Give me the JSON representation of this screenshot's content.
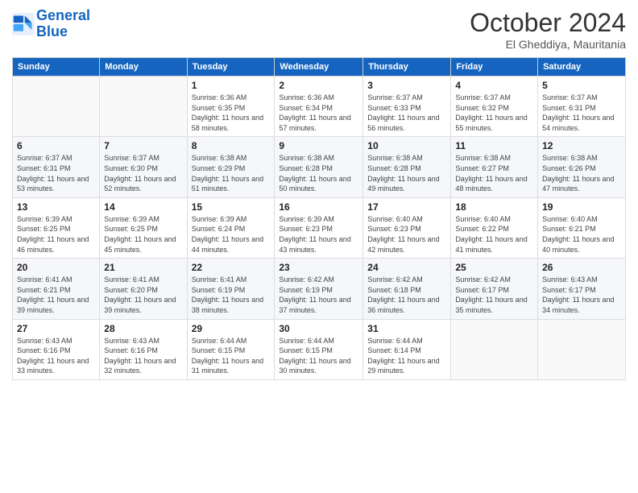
{
  "logo": {
    "line1": "General",
    "line2": "Blue"
  },
  "title": "October 2024",
  "location": "El Gheddiya, Mauritania",
  "days_of_week": [
    "Sunday",
    "Monday",
    "Tuesday",
    "Wednesday",
    "Thursday",
    "Friday",
    "Saturday"
  ],
  "weeks": [
    [
      {
        "day": "",
        "info": ""
      },
      {
        "day": "",
        "info": ""
      },
      {
        "day": "1",
        "info": "Sunrise: 6:36 AM\nSunset: 6:35 PM\nDaylight: 11 hours and 58 minutes."
      },
      {
        "day": "2",
        "info": "Sunrise: 6:36 AM\nSunset: 6:34 PM\nDaylight: 11 hours and 57 minutes."
      },
      {
        "day": "3",
        "info": "Sunrise: 6:37 AM\nSunset: 6:33 PM\nDaylight: 11 hours and 56 minutes."
      },
      {
        "day": "4",
        "info": "Sunrise: 6:37 AM\nSunset: 6:32 PM\nDaylight: 11 hours and 55 minutes."
      },
      {
        "day": "5",
        "info": "Sunrise: 6:37 AM\nSunset: 6:31 PM\nDaylight: 11 hours and 54 minutes."
      }
    ],
    [
      {
        "day": "6",
        "info": "Sunrise: 6:37 AM\nSunset: 6:31 PM\nDaylight: 11 hours and 53 minutes."
      },
      {
        "day": "7",
        "info": "Sunrise: 6:37 AM\nSunset: 6:30 PM\nDaylight: 11 hours and 52 minutes."
      },
      {
        "day": "8",
        "info": "Sunrise: 6:38 AM\nSunset: 6:29 PM\nDaylight: 11 hours and 51 minutes."
      },
      {
        "day": "9",
        "info": "Sunrise: 6:38 AM\nSunset: 6:28 PM\nDaylight: 11 hours and 50 minutes."
      },
      {
        "day": "10",
        "info": "Sunrise: 6:38 AM\nSunset: 6:28 PM\nDaylight: 11 hours and 49 minutes."
      },
      {
        "day": "11",
        "info": "Sunrise: 6:38 AM\nSunset: 6:27 PM\nDaylight: 11 hours and 48 minutes."
      },
      {
        "day": "12",
        "info": "Sunrise: 6:38 AM\nSunset: 6:26 PM\nDaylight: 11 hours and 47 minutes."
      }
    ],
    [
      {
        "day": "13",
        "info": "Sunrise: 6:39 AM\nSunset: 6:25 PM\nDaylight: 11 hours and 46 minutes."
      },
      {
        "day": "14",
        "info": "Sunrise: 6:39 AM\nSunset: 6:25 PM\nDaylight: 11 hours and 45 minutes."
      },
      {
        "day": "15",
        "info": "Sunrise: 6:39 AM\nSunset: 6:24 PM\nDaylight: 11 hours and 44 minutes."
      },
      {
        "day": "16",
        "info": "Sunrise: 6:39 AM\nSunset: 6:23 PM\nDaylight: 11 hours and 43 minutes."
      },
      {
        "day": "17",
        "info": "Sunrise: 6:40 AM\nSunset: 6:23 PM\nDaylight: 11 hours and 42 minutes."
      },
      {
        "day": "18",
        "info": "Sunrise: 6:40 AM\nSunset: 6:22 PM\nDaylight: 11 hours and 41 minutes."
      },
      {
        "day": "19",
        "info": "Sunrise: 6:40 AM\nSunset: 6:21 PM\nDaylight: 11 hours and 40 minutes."
      }
    ],
    [
      {
        "day": "20",
        "info": "Sunrise: 6:41 AM\nSunset: 6:21 PM\nDaylight: 11 hours and 39 minutes."
      },
      {
        "day": "21",
        "info": "Sunrise: 6:41 AM\nSunset: 6:20 PM\nDaylight: 11 hours and 39 minutes."
      },
      {
        "day": "22",
        "info": "Sunrise: 6:41 AM\nSunset: 6:19 PM\nDaylight: 11 hours and 38 minutes."
      },
      {
        "day": "23",
        "info": "Sunrise: 6:42 AM\nSunset: 6:19 PM\nDaylight: 11 hours and 37 minutes."
      },
      {
        "day": "24",
        "info": "Sunrise: 6:42 AM\nSunset: 6:18 PM\nDaylight: 11 hours and 36 minutes."
      },
      {
        "day": "25",
        "info": "Sunrise: 6:42 AM\nSunset: 6:17 PM\nDaylight: 11 hours and 35 minutes."
      },
      {
        "day": "26",
        "info": "Sunrise: 6:43 AM\nSunset: 6:17 PM\nDaylight: 11 hours and 34 minutes."
      }
    ],
    [
      {
        "day": "27",
        "info": "Sunrise: 6:43 AM\nSunset: 6:16 PM\nDaylight: 11 hours and 33 minutes."
      },
      {
        "day": "28",
        "info": "Sunrise: 6:43 AM\nSunset: 6:16 PM\nDaylight: 11 hours and 32 minutes."
      },
      {
        "day": "29",
        "info": "Sunrise: 6:44 AM\nSunset: 6:15 PM\nDaylight: 11 hours and 31 minutes."
      },
      {
        "day": "30",
        "info": "Sunrise: 6:44 AM\nSunset: 6:15 PM\nDaylight: 11 hours and 30 minutes."
      },
      {
        "day": "31",
        "info": "Sunrise: 6:44 AM\nSunset: 6:14 PM\nDaylight: 11 hours and 29 minutes."
      },
      {
        "day": "",
        "info": ""
      },
      {
        "day": "",
        "info": ""
      }
    ]
  ]
}
